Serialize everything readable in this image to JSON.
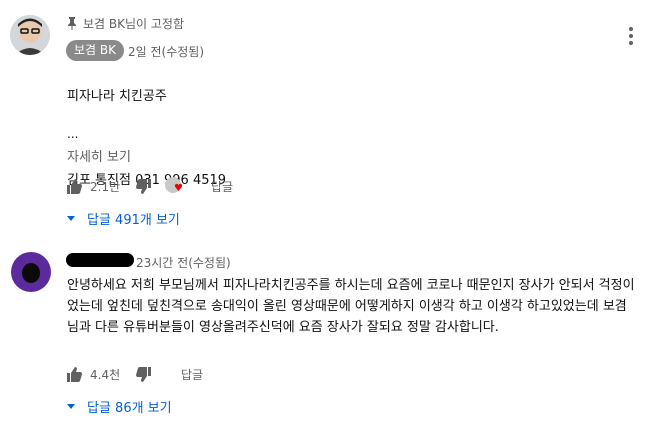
{
  "comments": [
    {
      "pinned_label": "보겸 BK님이 고정함",
      "author": "보겸 BK",
      "time": "2일 전(수정됨)",
      "body_line1": "피자나라 치킨공주",
      "body_line2": "김포 통진점 031 996 4519",
      "ellipsis": "...",
      "read_more": "자세히 보기",
      "likes": "2.1만",
      "reply_label": "답글",
      "replies": "답글 491개 보기"
    },
    {
      "time": "23시간 전(수정됨)",
      "body": "안녕하세요 저희 부모님께서 피자나라치킨공주를 하시는데 요즘에 코로나 때문인지 장사가 안되서 걱정이었는데 엎친데 덮친격으로 송대익이 올린 영상때문에 어떻게하지 이생각 하고 이생각 하고있었는데 보겸님과 다른 유튜버분들이 영상올려주신덕에 요즘 장사가 잘되요 정말 감사합니다.",
      "likes": "4.4천",
      "reply_label": "답글",
      "replies": "답글 86개 보기"
    }
  ],
  "colors": {
    "link": "#065fd4",
    "muted": "#606060",
    "badge": "#8a8a8a"
  },
  "icons": [
    "pin-icon",
    "like-icon",
    "dislike-icon",
    "heart-icon",
    "more-vert-icon",
    "caret-down-icon"
  ]
}
